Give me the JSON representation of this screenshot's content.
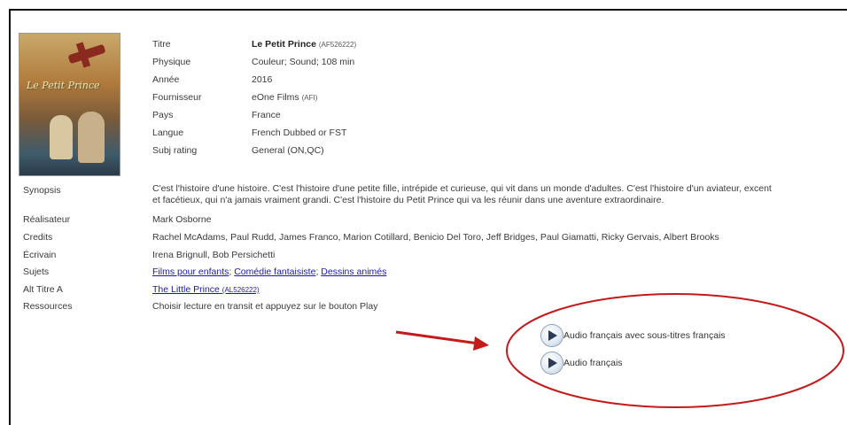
{
  "poster": {
    "title_text": "Le Petit Prince"
  },
  "details": [
    {
      "label": "Titre",
      "value": "Le Petit Prince",
      "code": "(AF526222)"
    },
    {
      "label": "Physique",
      "value": "Couleur; Sound; 108 min"
    },
    {
      "label": "Année",
      "value": "2016"
    },
    {
      "label": "Fournisseur",
      "value": "eOne Films",
      "code": "(AFI)"
    },
    {
      "label": "Pays",
      "value": "France"
    },
    {
      "label": "Langue",
      "value": "French Dubbed or FST"
    },
    {
      "label": "Subj rating",
      "value": "General (ON,QC)"
    }
  ],
  "synopsis": {
    "label": "Synopsis",
    "line1": "C'est l'histoire d'une histoire. C'est l'histoire d'une petite fille, intrépide et curieuse, qui vit dans un monde d'adultes. C'est l'histoire d'un aviateur, excent",
    "line2": "et facétieux, qui n'a jamais vraiment grandi. C'est l'histoire du Petit Prince qui va les réunir dans une aventure extraordinaire."
  },
  "realisateur": {
    "label": "Réalisateur",
    "value": "Mark Osborne"
  },
  "credits": {
    "label": "Credits",
    "value": "Rachel McAdams, Paul Rudd, James Franco, Marion Cotillard, Benicio Del Toro, Jeff Bridges, Paul Giamatti, Ricky Gervais, Albert Brooks"
  },
  "ecrivain": {
    "label": "Écrivain",
    "value": "Irena Brignull, Bob Persichetti"
  },
  "sujets": {
    "label": "Sujets",
    "links": [
      "Films pour enfants",
      "Comédie fantaisiste",
      "Dessins animés"
    ],
    "sep": ";"
  },
  "alt_titre": {
    "label": "Alt Titre A",
    "link": "The Little Prince",
    "code": "(AL526222)"
  },
  "ressources": {
    "label": "Ressources",
    "value": "Choisir lecture en transit et appuyez sur le bouton Play"
  },
  "play_options": [
    {
      "label": "Audio français avec sous-titres français"
    },
    {
      "label": "Audio français"
    }
  ],
  "annotation_color": "#c41a1a"
}
